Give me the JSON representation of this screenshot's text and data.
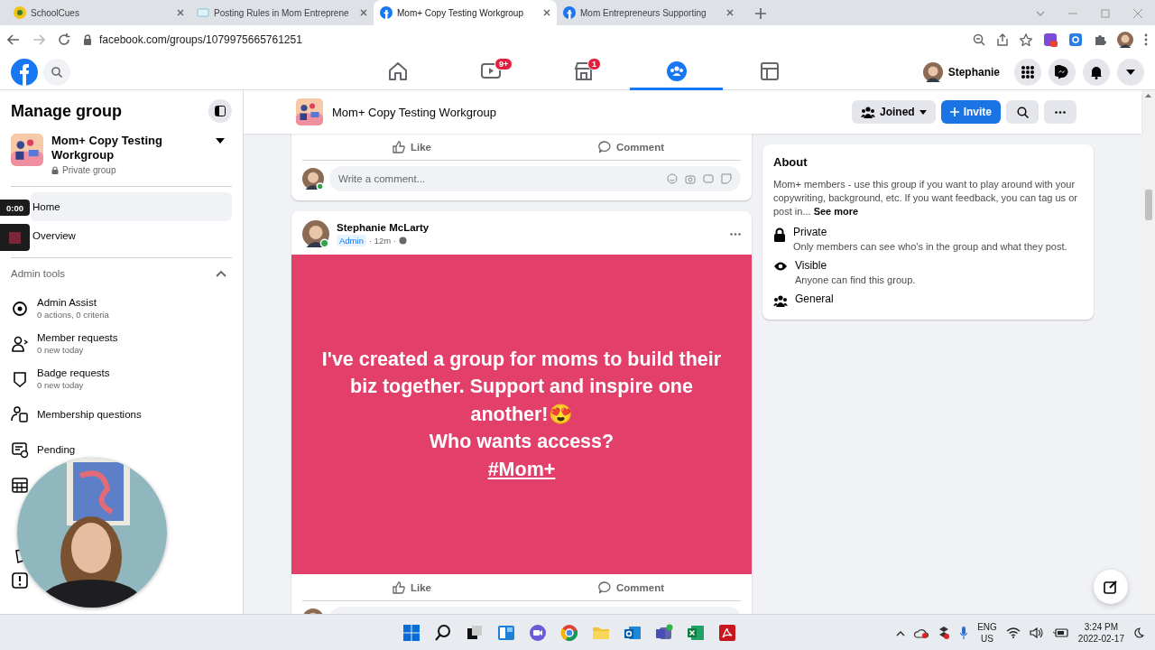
{
  "browser": {
    "tabs": [
      {
        "title": "SchoolCues",
        "kind": "schoolcues",
        "selected": false
      },
      {
        "title": "Posting Rules in Mom Entreprene",
        "kind": "doc",
        "selected": false
      },
      {
        "title": "Mom+ Copy Testing Workgroup",
        "kind": "facebook",
        "selected": true
      },
      {
        "title": "Mom Entrepreneurs Supporting",
        "kind": "facebook",
        "selected": false
      }
    ],
    "url": "facebook.com/groups/1079975665761251"
  },
  "facebook": {
    "nav": [
      {
        "kind": "home",
        "selected": false
      },
      {
        "kind": "watch",
        "badge": "9+",
        "selected": false
      },
      {
        "kind": "marketplace",
        "badge": "1",
        "selected": false
      },
      {
        "kind": "groups",
        "selected": true
      },
      {
        "kind": "gaming",
        "selected": false
      }
    ],
    "user": "Stephanie"
  },
  "recorder": {
    "timer": "0:00"
  },
  "sidebar": {
    "title": "Manage group",
    "group_name": "Mom+ Copy Testing Workgroup",
    "privacy": "Private group",
    "nav": [
      {
        "label": "Home",
        "selected": true
      },
      {
        "label": "Overview",
        "selected": false
      }
    ],
    "admin_tools": {
      "title": "Admin tools",
      "expanded": true,
      "items": [
        {
          "kind": "assist",
          "title": "Admin Assist",
          "subtitle": "0 actions, 0 criteria"
        },
        {
          "kind": "person-add",
          "title": "Member requests",
          "subtitle": "0 new today"
        },
        {
          "kind": "badge",
          "title": "Badge requests",
          "subtitle": "0 new today"
        },
        {
          "kind": "questions",
          "title": "Membership questions"
        },
        {
          "kind": "pending",
          "title": "Pending"
        },
        {
          "kind": "calendar"
        },
        {
          "kind": "book"
        },
        {
          "kind": "alert"
        }
      ]
    }
  },
  "group_header": {
    "name": "Mom+ Copy Testing Workgroup",
    "joined": "Joined",
    "invite": "Invite"
  },
  "feed": {
    "previous_post": {
      "actions": [
        "Like",
        "Comment"
      ],
      "comment_placeholder": "Write a comment..."
    },
    "post": {
      "author": "Stephanie McLarty",
      "role": "Admin",
      "time": "· 12m ·",
      "lines": [
        "I've created a group for moms to build their biz together. Support and inspire one another!😍",
        "Who wants access?"
      ],
      "hashtag": "#Mom+",
      "actions": [
        "Like",
        "Comment"
      ]
    }
  },
  "about": {
    "title": "About",
    "description": "Mom+ members - use this group if you want to play around with your copywriting, background, etc. If you want feedback, you can tag us or post in...",
    "see_more": "See more",
    "items": [
      {
        "kind": "lock",
        "title": "Private",
        "description": "Only members can see who's in the group and what they post."
      },
      {
        "kind": "eye",
        "title": "Visible",
        "description": "Anyone can find this group."
      },
      {
        "kind": "people",
        "title": "General"
      }
    ]
  },
  "taskbar": {
    "language": "ENG",
    "region": "US",
    "time": "3:24 PM",
    "date": "2022-02-17"
  }
}
